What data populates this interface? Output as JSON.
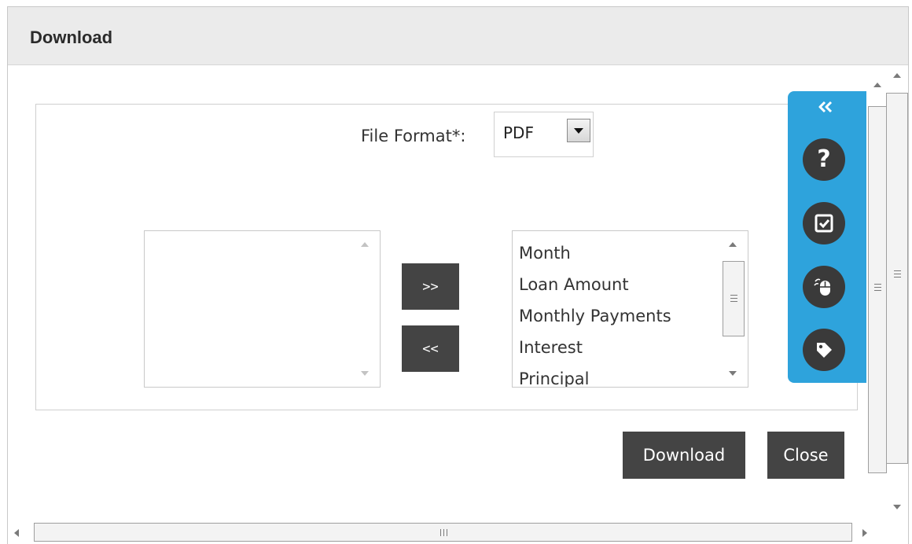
{
  "dialog": {
    "title": "Download"
  },
  "form": {
    "file_format_label": "File Format*:",
    "file_format_value": "PDF"
  },
  "available_columns": {
    "items": []
  },
  "selected_columns": {
    "items": [
      "Month",
      "Loan Amount",
      "Monthly Payments",
      "Interest",
      "Principal"
    ]
  },
  "move_buttons": {
    "add_label": ">>",
    "remove_label": "<<"
  },
  "actions": {
    "download_label": "Download",
    "close_label": "Close"
  },
  "side_toolbar": {
    "collapse_icon": "double-chevron-left-icon",
    "help_glyph": "?",
    "tools": [
      "help-icon",
      "checkbox-screen-icon",
      "mouse-icon",
      "tag-icon"
    ]
  },
  "colors": {
    "header_bg": "#ebebeb",
    "button_bg": "#444444",
    "side_panel_bg": "#2ea3dc",
    "tool_circle_bg": "#3a3a3a"
  }
}
